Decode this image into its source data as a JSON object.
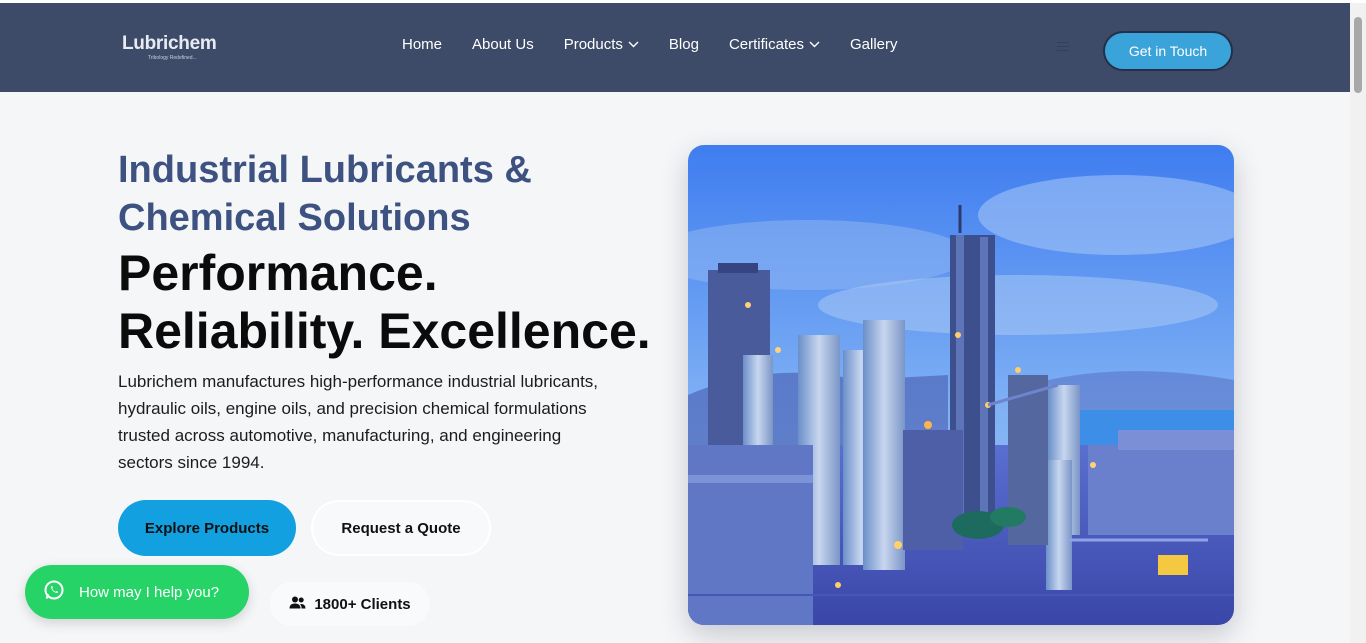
{
  "brand": {
    "logo_text": "Lubrichem",
    "logo_tagline": "Tribology Redefined..."
  },
  "nav": {
    "items": [
      {
        "label": "Home",
        "dropdown": false
      },
      {
        "label": "About Us",
        "dropdown": false
      },
      {
        "label": "Products",
        "dropdown": true
      },
      {
        "label": "Blog",
        "dropdown": false
      },
      {
        "label": "Certificates",
        "dropdown": true
      },
      {
        "label": "Gallery",
        "dropdown": false
      }
    ],
    "cta_label": "Get in Touch"
  },
  "hero": {
    "subtitle": "Industrial Lubricants & Chemical Solutions",
    "title": "Performance. Reliability. Excellence.",
    "description": "Lubrichem manufactures high-performance industrial lubricants, hydraulic oils, engine oils, and precision chemical formulations trusted across automotive, manufacturing, and engineering sectors since 1994.",
    "primary_button": "Explore Products",
    "secondary_button": "Request a Quote",
    "clients_badge": "1800+ Clients",
    "image_icon": "industrial-plant-photo"
  },
  "whatsapp": {
    "label": "How may I help you?",
    "icon": "whatsapp-icon"
  },
  "colors": {
    "navbar": "#3d4b68",
    "accent": "#3aa3d9",
    "primary_button": "#12a0e0",
    "heading_blue": "#3d5280",
    "whatsapp_green": "#25d366",
    "background": "#f5f6f8"
  }
}
